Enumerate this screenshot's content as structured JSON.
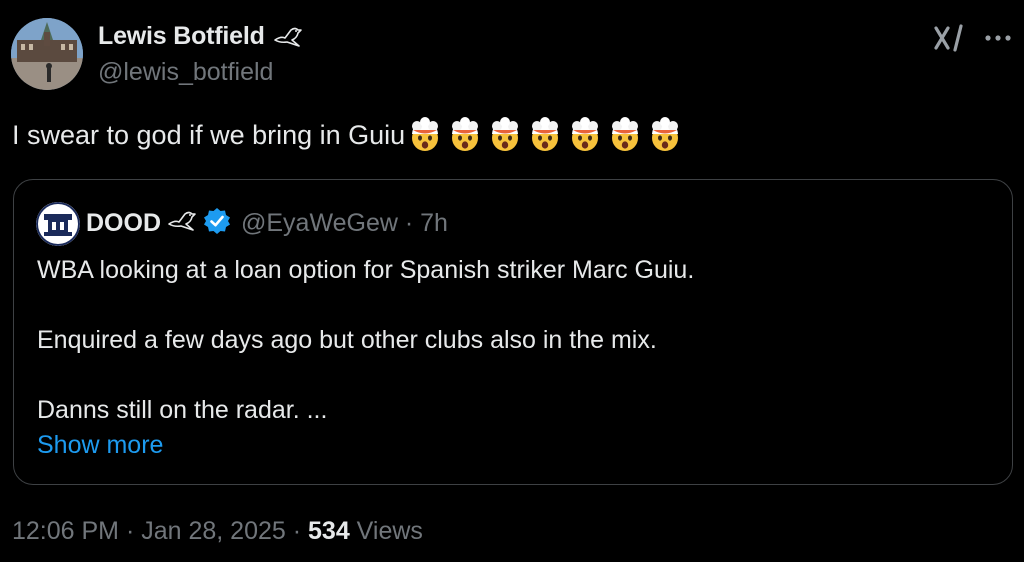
{
  "author": {
    "name": "Lewis Botfield",
    "handle": "@lewis_botfield"
  },
  "tweet": {
    "text": "I swear to god if we bring in Guiu",
    "emoji_count": 7,
    "emoji_icon": "exploding-head-emoji"
  },
  "quote": {
    "name": "DOOD",
    "handle_time": "@EyaWeGew · 7h",
    "lines": [
      "WBA looking at a loan option for Spanish striker Marc Guiu.",
      "Enquired a few days ago but other clubs also in the mix.",
      "Danns still on the radar. ..."
    ],
    "show_more": "Show more"
  },
  "meta": {
    "time_date": "12:06 PM · Jan 28, 2025 · ",
    "views_count": "534",
    "views_label": " Views"
  },
  "colors": {
    "background": "#000000",
    "text": "#e7e9ea",
    "muted": "#71767b",
    "link": "#1d9bf0",
    "border": "#3e4144",
    "verified": "#1d9bf0"
  }
}
